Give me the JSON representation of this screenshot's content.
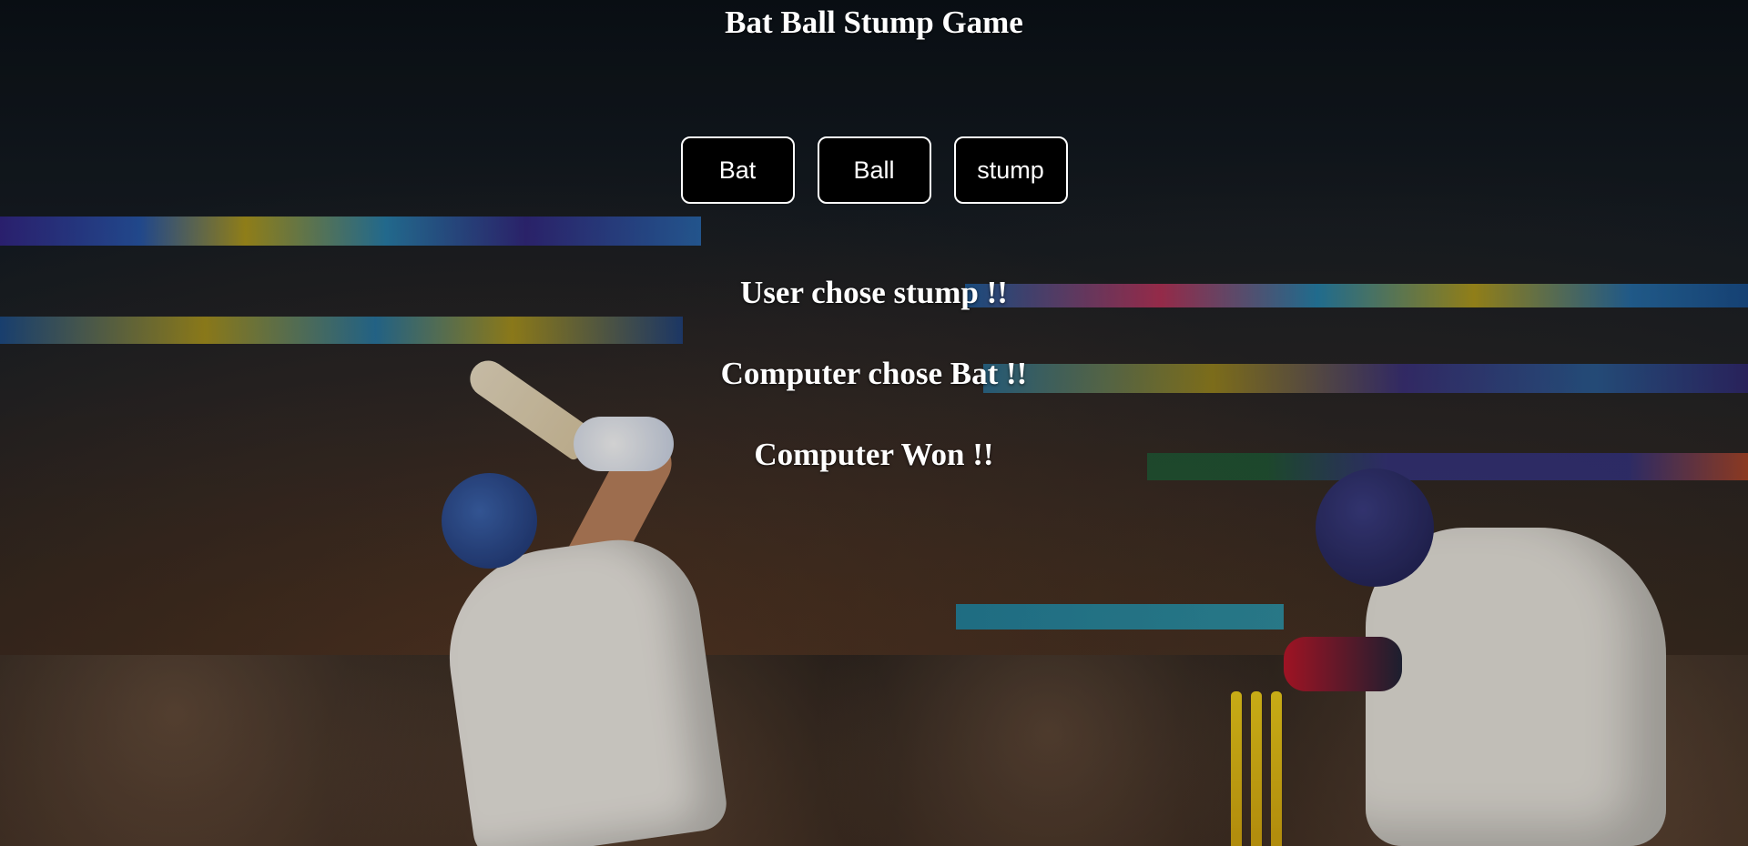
{
  "page": {
    "title": "Bat Ball Stump Game"
  },
  "choices": {
    "bat_label": "Bat",
    "ball_label": "Ball",
    "stump_label": "stump"
  },
  "results": {
    "user_choice": "User chose stump !!",
    "computer_choice": "Computer chose Bat !!",
    "outcome": "Computer Won !!"
  },
  "theme": {
    "button_bg": "#000000",
    "button_border": "#ffffff",
    "text_color": "#ffffff"
  }
}
